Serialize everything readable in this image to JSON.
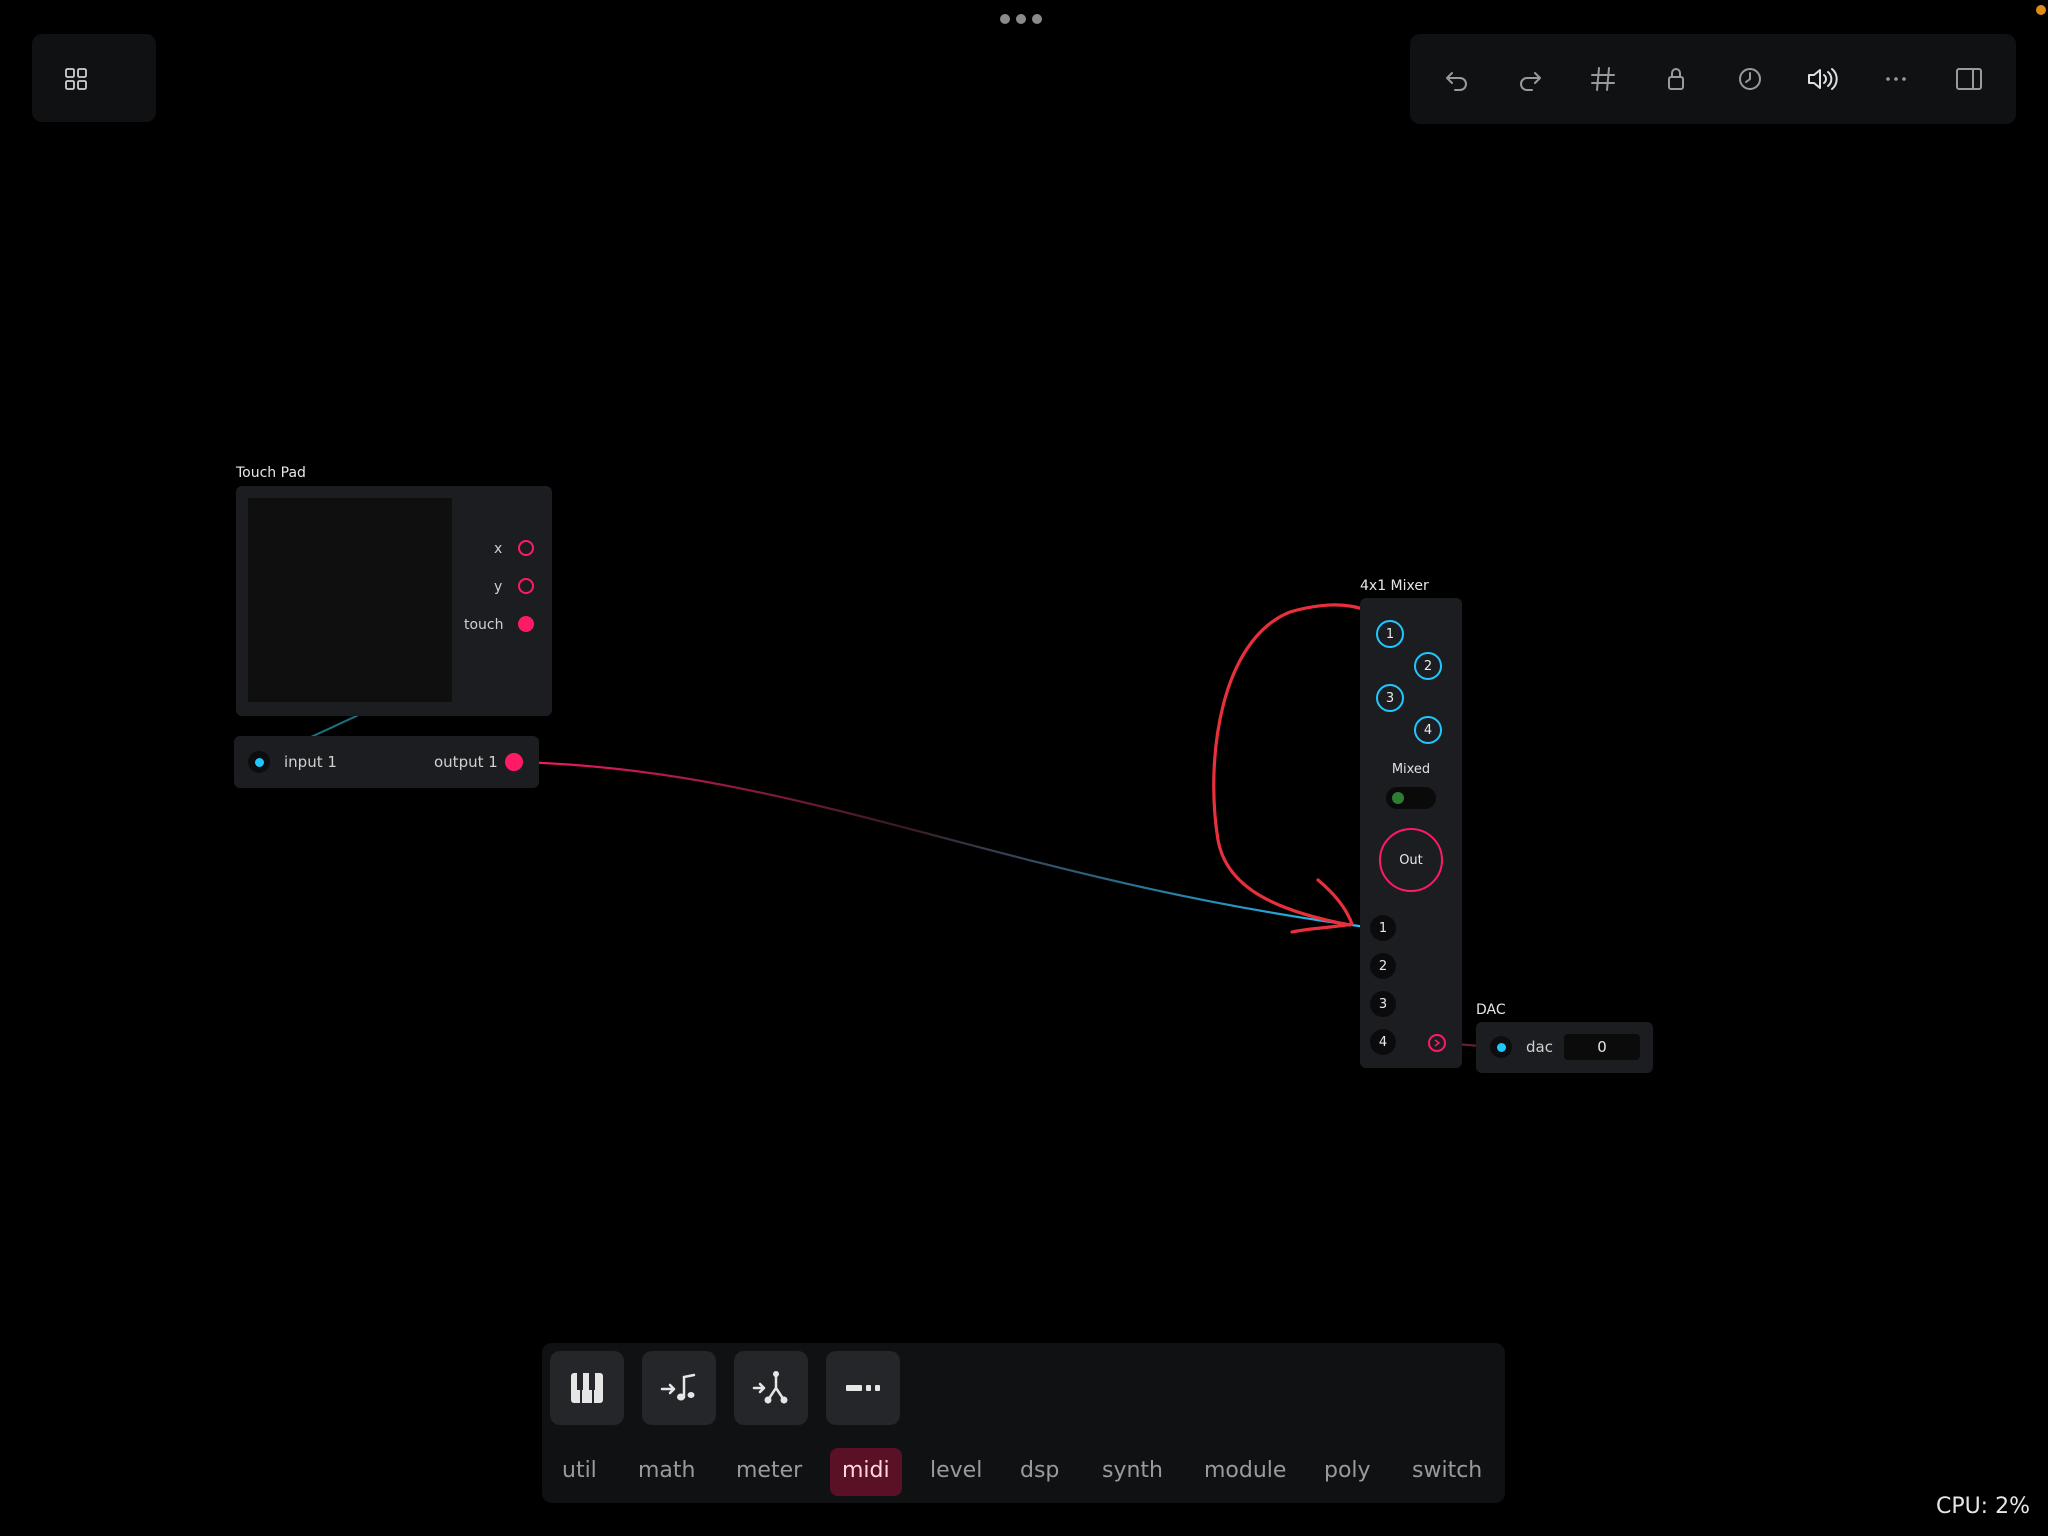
{
  "window": {
    "dots": "•••"
  },
  "toolbar": {
    "buttons": [
      "undo-icon",
      "redo-icon",
      "grid-hash-icon",
      "lock-icon",
      "history-icon",
      "speaker-icon",
      "more-icon",
      "sidebar-icon"
    ]
  },
  "modules": {
    "touchpad": {
      "title": "Touch Pad",
      "outputs": [
        "x",
        "y",
        "touch"
      ],
      "input_label": "input 1",
      "output_label": "output 1"
    },
    "mixer": {
      "title": "4x1 Mixer",
      "knobs": [
        "1",
        "2",
        "3",
        "4"
      ],
      "mixed_label": "Mixed",
      "out_label": "Out",
      "inputs": [
        "1",
        "2",
        "3",
        "4"
      ]
    },
    "dac": {
      "title": "DAC",
      "label": "dac",
      "value": "0"
    }
  },
  "palette": {
    "icons": [
      "piano-keys-icon",
      "note-input-icon",
      "note-split-icon",
      "dash-icon"
    ],
    "categories": [
      "util",
      "math",
      "meter",
      "midi",
      "level",
      "dsp",
      "synth",
      "module",
      "poly",
      "switch"
    ],
    "active_category": "midi"
  },
  "status": {
    "cpu": "CPU: 2%"
  },
  "colors": {
    "accent_pink": "#ff1a66",
    "accent_cyan": "#1ec8ff",
    "annotation_red": "#e8303a"
  }
}
